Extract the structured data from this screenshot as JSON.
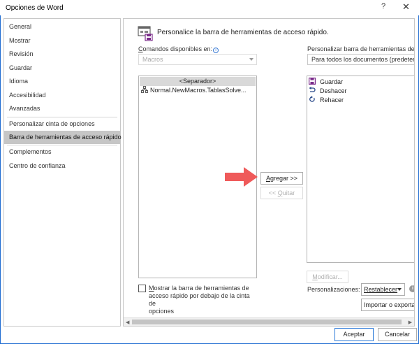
{
  "window": {
    "title": "Opciones de Word",
    "help_label": "?",
    "close_label": "✕",
    "accent": "#2b79d8"
  },
  "sidebar": {
    "items": [
      {
        "label": "General"
      },
      {
        "label": "Mostrar"
      },
      {
        "label": "Revisión"
      },
      {
        "label": "Guardar"
      },
      {
        "label": "Idioma"
      },
      {
        "label": "Accesibilidad"
      },
      {
        "label": "Avanzadas"
      },
      {
        "label": "Personalizar cinta de opciones"
      },
      {
        "label": "Barra de herramientas de acceso rápido",
        "selected": true
      },
      {
        "label": "Complementos"
      },
      {
        "label": "Centro de confianza"
      }
    ]
  },
  "main": {
    "header_icon": "quick-access-toolbar-icon",
    "header": "Personalice la barra de herramientas de acceso rápido.",
    "commands_label": "Comandos disponibles en:",
    "commands_label_underlined": "C",
    "commands_label_rest": "omandos disponibles en:",
    "commands_value": "Macros",
    "separator_item": "<Separador>",
    "macro_item": "Normal.NewMacros.TablasSolve...",
    "macro_icon": "macro-flowchart-icon",
    "customize_label": "Personalizar barra de herramientas de acc",
    "customize_value": "Para todos los documentos (predeterm",
    "qat_items": [
      {
        "label": "Guardar",
        "icon": "save-icon"
      },
      {
        "label": "Deshacer",
        "icon": "undo-icon"
      },
      {
        "label": "Rehacer",
        "icon": "redo-icon"
      }
    ],
    "add_button": "Agregar >>",
    "add_button_underlined": "A",
    "add_button_rest": "gregar >>",
    "remove_button": "<< Quitar",
    "remove_button_prefix": "<< ",
    "remove_button_underlined": "Q",
    "remove_button_rest": "uitar",
    "modify_button": "Modificar...",
    "modify_button_underlined": "M",
    "modify_button_rest": "odificar...",
    "show_below_ribbon_label": "Mostrar la barra de herramientas de acceso rápido por debajo de la cinta de opciones",
    "show_below_ribbon_l1": "Mostrar la barra de herramientas de",
    "show_below_ribbon_l2": "acceso rápido por debajo de la cinta de",
    "show_below_ribbon_l3": "opciones",
    "show_below_ribbon_underlined": "M",
    "show_below_ribbon_l1_rest": "ostrar la barra de herramientas de",
    "show_below_ribbon_checked": false,
    "customizations_label": "Personalizaciones:",
    "reset_button": "Restablecer",
    "import_export_button": "Importar o exportar",
    "arrow_color": "#ef5a5a"
  },
  "footer": {
    "ok_button": "Aceptar",
    "cancel_button": "Cancelar"
  }
}
